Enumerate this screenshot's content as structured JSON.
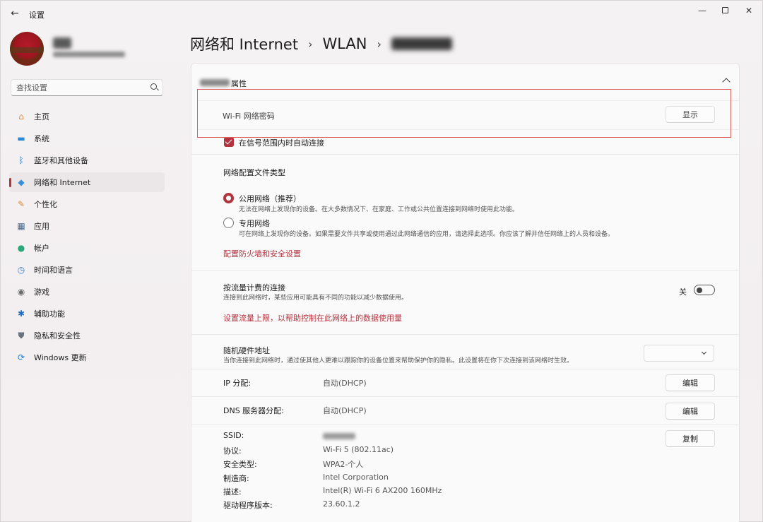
{
  "window": {
    "title": "设置",
    "back_glyph": "←",
    "min_glyph": "—",
    "close_glyph": "✕"
  },
  "search": {
    "placeholder": "查找设置"
  },
  "sidebar": {
    "items": [
      {
        "label": "主页",
        "icon": "home-icon",
        "glyph": "⌂",
        "color": "#d88b46",
        "active": false
      },
      {
        "label": "系统",
        "icon": "system-icon",
        "glyph": "▬",
        "color": "#2a8ad6",
        "active": false
      },
      {
        "label": "蓝牙和其他设备",
        "icon": "bluetooth-icon",
        "glyph": "ᛒ",
        "color": "#1f73c8",
        "active": false
      },
      {
        "label": "网络和 Internet",
        "icon": "wifi-icon",
        "glyph": "◆",
        "color": "#3a8fd8",
        "active": true
      },
      {
        "label": "个性化",
        "icon": "brush-icon",
        "glyph": "✎",
        "color": "#d78a3a",
        "active": false
      },
      {
        "label": "应用",
        "icon": "apps-icon",
        "glyph": "▦",
        "color": "#4a6a8a",
        "active": false
      },
      {
        "label": "帐户",
        "icon": "account-icon",
        "glyph": "●",
        "color": "#2aa87a",
        "active": false
      },
      {
        "label": "时间和语言",
        "icon": "globe-clock-icon",
        "glyph": "◷",
        "color": "#2a7ac8",
        "active": false
      },
      {
        "label": "游戏",
        "icon": "gamepad-icon",
        "glyph": "◉",
        "color": "#6a6a6a",
        "active": false
      },
      {
        "label": "辅助功能",
        "icon": "accessibility-icon",
        "glyph": "✱",
        "color": "#1e6fc2",
        "active": false
      },
      {
        "label": "隐私和安全性",
        "icon": "shield-icon",
        "glyph": "⛊",
        "color": "#6a7280",
        "active": false
      },
      {
        "label": "Windows 更新",
        "icon": "update-icon",
        "glyph": "⟳",
        "color": "#1f78cf",
        "active": false
      }
    ]
  },
  "breadcrumb": {
    "items": [
      "网络和 Internet",
      "WLAN"
    ],
    "separator": "›"
  },
  "section": {
    "title": "属性"
  },
  "wifi_password": {
    "label": "Wi-Fi 网络密码",
    "button": "显示"
  },
  "auto_connect": {
    "label": "在信号范围内时自动连接",
    "checked": true
  },
  "profile_type": {
    "heading": "网络配置文件类型",
    "public_label": "公用网络（推荐）",
    "public_desc": "无法在网络上发现你的设备。在大多数情况下、在家庭、工作或公共位置连接到网络时使用此功能。",
    "private_label": "专用网络",
    "private_desc": "可在网络上发现你的设备。如果需要文件共享或使用通过此网络通信的应用，请选择此选项。你应该了解并信任网络上的人员和设备。",
    "selected": "public",
    "firewall_link": "配置防火墙和安全设置"
  },
  "metered": {
    "label": "按流量计费的连接",
    "desc": "连接到此网络时，某些应用可能具有不同的功能以减少数据使用。",
    "state_label": "关",
    "on": false,
    "limit_link": "设置流量上限，以帮助控制在此网络上的数据使用量"
  },
  "random_mac": {
    "label": "随机硬件地址",
    "desc": "当你连接到此网络时，通过使其他人更难以跟踪你的设备位置来帮助保护你的隐私。此设置将在你下次连接到该网络时生效。",
    "value": ""
  },
  "ip_assignment": {
    "label": "IP 分配:",
    "value": "自动(DHCP)",
    "button": "编辑"
  },
  "dns_assignment": {
    "label": "DNS 服务器分配:",
    "value": "自动(DHCP)",
    "button": "编辑"
  },
  "properties": {
    "copy_button": "复制",
    "ssid_label": "SSID:",
    "protocol_label": "协议:",
    "protocol_value": "Wi-Fi 5 (802.11ac)",
    "security_label": "安全类型:",
    "security_value": "WPA2-个人",
    "manufacturer_label": "制造商:",
    "manufacturer_value": "Intel Corporation",
    "description_label": "描述:",
    "description_value": "Intel(R) Wi-Fi 6 AX200 160MHz",
    "driver_label": "驱动程序版本:",
    "driver_value": "23.60.1.2"
  },
  "colors": {
    "accent": "#b1343f",
    "annotation": "#d9605f"
  }
}
